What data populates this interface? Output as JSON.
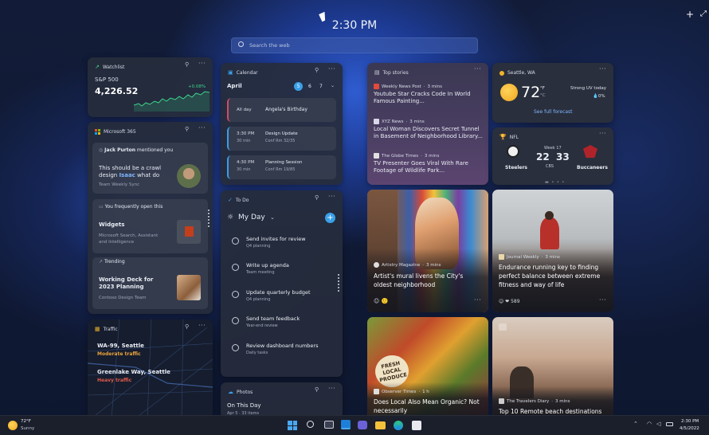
{
  "header": {
    "time": "2:30 PM",
    "search_placeholder": "Search the web",
    "add_icon": "plus-icon",
    "expand_icon": "expand-icon"
  },
  "watchlist": {
    "title": "Watchlist",
    "symbol": "S&P 500",
    "value": "4,226.52",
    "change": "+0.08%"
  },
  "m365": {
    "title": "Microsoft 365",
    "mention_name": "Jack Purton",
    "mention_text": "mentioned you",
    "message_pre": "This should be a crawl design ",
    "message_name": "Isaac",
    "message_post": " what do",
    "message_meta": "Team Weekly Sync",
    "open_label": "You frequently open this",
    "file_name": "Widgets",
    "file_sub": "Microsoft Search, Assistant and Intelligence",
    "trending_label": "Trending",
    "trend_name": "Working Deck for 2023 Planning",
    "trend_sub": "Contoso Design Team"
  },
  "traffic": {
    "title": "Traffic",
    "route1": "WA-99, Seattle",
    "status1": "Moderate traffic",
    "route2": "Greenlake Way, Seattle",
    "status2": "Heavy traffic"
  },
  "calendar": {
    "title": "Calendar",
    "month": "April",
    "days": [
      "5",
      "6",
      "7"
    ],
    "events": [
      {
        "time": "All day",
        "duration": "",
        "title": "Angela's Birthday",
        "location": ""
      },
      {
        "time": "3:30 PM",
        "duration": "30 min",
        "title": "Design Update",
        "location": "Conf Rm 32/35"
      },
      {
        "time": "4:30 PM",
        "duration": "30 min",
        "title": "Planning Session",
        "location": "Conf Rm 19/85"
      }
    ]
  },
  "todo": {
    "title": "To Do",
    "list_name": "My Day",
    "items": [
      {
        "title": "Send invites for review",
        "sub": "Q4 planning"
      },
      {
        "title": "Write up agenda",
        "sub": "Team meeting"
      },
      {
        "title": "Update quarterly budget",
        "sub": "Q4 planning"
      },
      {
        "title": "Send team feedback",
        "sub": "Year-end review"
      },
      {
        "title": "Review dashboard numbers",
        "sub": "Daily tasks"
      }
    ]
  },
  "photos": {
    "title": "Photos",
    "label": "On This Day",
    "date": "Apr 5",
    "count": "33 items"
  },
  "top_stories": {
    "title": "Top stories",
    "stories": [
      {
        "source": "Weekly News Post",
        "age": "3 mins",
        "headline": "Youtube Star Cracks Code In World Famous Painting..."
      },
      {
        "source": "XYZ News",
        "age": "3 mins",
        "headline": "Local Woman Discovers Secret Tunnel in Basement of Neighborhood Library..."
      },
      {
        "source": "The Globe Times",
        "age": "3 mins",
        "headline": "TV Presenter Goes Viral With Rare Footage of Wildlife Park..."
      }
    ]
  },
  "weather": {
    "location": "Seattle, WA",
    "temp": "72",
    "unit_f": "°F",
    "unit_c": "°C",
    "condition": "Strong UV today",
    "precip": "0%",
    "forecast_link": "See full forecast"
  },
  "nfl": {
    "title": "NFL",
    "team1": "Steelers",
    "team2": "Buccaneers",
    "date": "Week 17",
    "score1": "22",
    "score2": "33",
    "network": "CBS"
  },
  "articles": [
    {
      "source": "Artistry Magazine",
      "age": "3 mins",
      "headline": "Artist's mural livens the City's oldest neighborhood"
    },
    {
      "source": "Journal Weekly",
      "age": "3 mins",
      "headline": "Endurance running key to finding perfect balance between extreme fitness and way of life",
      "count": "589"
    },
    {
      "source": "Observer Times",
      "age": "1 h",
      "headline": "Does Local Also Mean Organic? Not necessarily"
    },
    {
      "source": "The Travelers Diary",
      "age": "3 mins",
      "headline": "Top 10 Remote beach destinations"
    }
  ],
  "taskbar": {
    "weather_temp": "72°F",
    "weather_cond": "Sunny",
    "time": "2:30 PM",
    "date": "4/5/2022"
  },
  "colors": {
    "accent": "#3aa0e8",
    "stock_green": "#3dd68c",
    "traffic_moderate": "#e8a23c",
    "traffic_heavy": "#e05a4a",
    "weather_sun": "#f3b32a"
  }
}
